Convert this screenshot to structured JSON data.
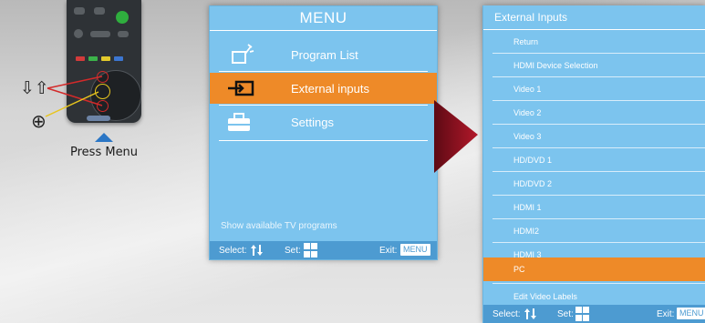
{
  "remote": {
    "press_label": "Press Menu"
  },
  "menu": {
    "title": "MENU",
    "items": [
      {
        "label": "Program List",
        "icon": "program-list-icon",
        "active": false
      },
      {
        "label": "External inputs",
        "icon": "external-inputs-icon",
        "active": true
      },
      {
        "label": "Settings",
        "icon": "settings-toolbox-icon",
        "active": false
      }
    ],
    "hint": "Show available TV programs",
    "footer": {
      "select_label": "Select:",
      "set_label": "Set:",
      "exit_label": "Exit:",
      "exit_key": "MENU"
    }
  },
  "external_inputs": {
    "title": "External Inputs",
    "items": [
      {
        "label": "Return",
        "active": false
      },
      {
        "label": "HDMI Device Selection",
        "active": false
      },
      {
        "label": "Video 1",
        "active": false
      },
      {
        "label": "Video 2",
        "active": false
      },
      {
        "label": "Video 3",
        "active": false
      },
      {
        "label": "HD/DVD 1",
        "active": false
      },
      {
        "label": "HD/DVD 2",
        "active": false
      },
      {
        "label": "HDMI 1",
        "active": false
      },
      {
        "label": "HDMI2",
        "active": false
      },
      {
        "label": "HDMI 3",
        "active": false
      },
      {
        "label": "PC",
        "active": true
      },
      {
        "label": "Edit Video Labels",
        "active": false
      }
    ],
    "footer": {
      "select_label": "Select:",
      "set_label": "Set:",
      "exit_label": "Exit:",
      "exit_key": "MENU"
    }
  },
  "colors": {
    "panel_blue": "#7cc4ee",
    "footer_blue": "#4d9bd1",
    "highlight_orange": "#ee8a28",
    "connector_red": "#8e1422",
    "press_arrow_blue": "#2b76c5"
  }
}
